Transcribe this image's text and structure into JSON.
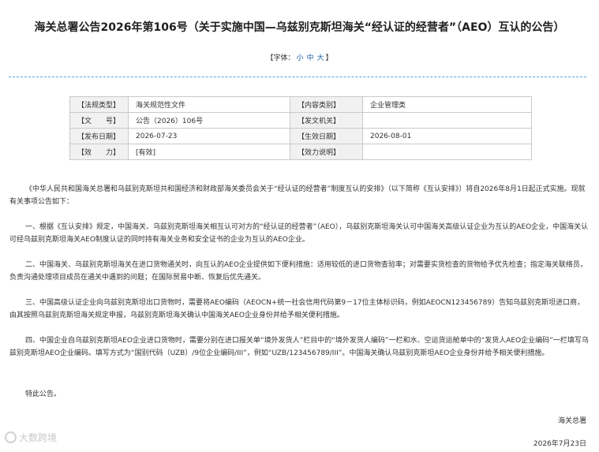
{
  "title": "海关总署公告2026年第106号（关于实施中国—乌兹别克斯坦海关“经认证的经营者”（AEO）互认的公告）",
  "font_size": {
    "prefix": "【字体：",
    "small": "小",
    "medium": "中",
    "large": "大",
    "suffix": "】"
  },
  "meta": {
    "rows": [
      {
        "label": "【法规类型】",
        "value": "海关规范性文件",
        "label2": "【内容类别】",
        "value2": "企业管理类"
      },
      {
        "label": "【文　　号】",
        "value": "公告（2026）106号",
        "label2": "【发文机关】",
        "value2": ""
      },
      {
        "label": "【发布日期】",
        "value": "2026-07-23",
        "label2": "【生效日期】",
        "value2": "2026-08-01"
      },
      {
        "label": "【效　　力】",
        "value": "[有效]",
        "label2": "【效力说明】",
        "value2": ""
      }
    ]
  },
  "body": {
    "p0": "《中华人民共和国海关总署和乌兹别克斯坦共和国经济和财政部海关委员会关于“经认证的经营者”制度互认的安排》（以下简称《互认安排》）将自2026年8月1日起正式实施。现就有关事项公告如下：",
    "p1": "一、根据《互认安排》规定，中国海关、乌兹别克斯坦海关相互认可对方的“经认证的经营者”（AEO），乌兹别克斯坦海关认可中国海关高级认证企业为互认的AEO企业，中国海关认可经乌兹别克斯坦海关AEO制度认证的同时持有海关业务和安全证书的企业为互认的AEO企业。",
    "p2": "二、中国海关、乌兹别克斯坦海关在进口货物通关时，向互认的AEO企业提供如下便利措施：适用较低的进口货物查验率；对需要实货检查的货物给予优先检查；指定海关联络员，负责沟通处理项目成员在通关中遇到的问题；在国际贸易中断、恢复后优先通关。",
    "p3": "三、中国高级认证企业向乌兹别克斯坦出口货物时，需要将AEO编码（AEOCN+统一社会信用代码第9－17位主体标识码，例如AEOCN123456789）告知乌兹别克斯坦进口商，由其按照乌兹别克斯坦海关规定申报，乌兹别克斯坦海关确认中国海关AEO企业身份并给予相关便利措施。",
    "p4": "四、中国企业自乌兹别克斯坦AEO企业进口货物时，需要分别在进口报关单“境外发货人”栏目中的“境外发货人编码”一栏和水、空运货运舱单中的“发货人AEO企业编码”一栏填写乌兹别克斯坦AEO企业编码。填写方式为“国别代码（UZB）/9位企业编码/III”，例如“UZB/123456789/III”。中国海关确认乌兹别克斯坦AEO企业身份并给予相关便利措施。",
    "p5": "特此公告。"
  },
  "signature": "海关总署",
  "date": "2026年7月23日",
  "watermark": "大数跨境",
  "colors": {
    "link": "#1a5fa8",
    "divider": "#58a7d9",
    "table_label_bg": "#f1f1f1"
  }
}
